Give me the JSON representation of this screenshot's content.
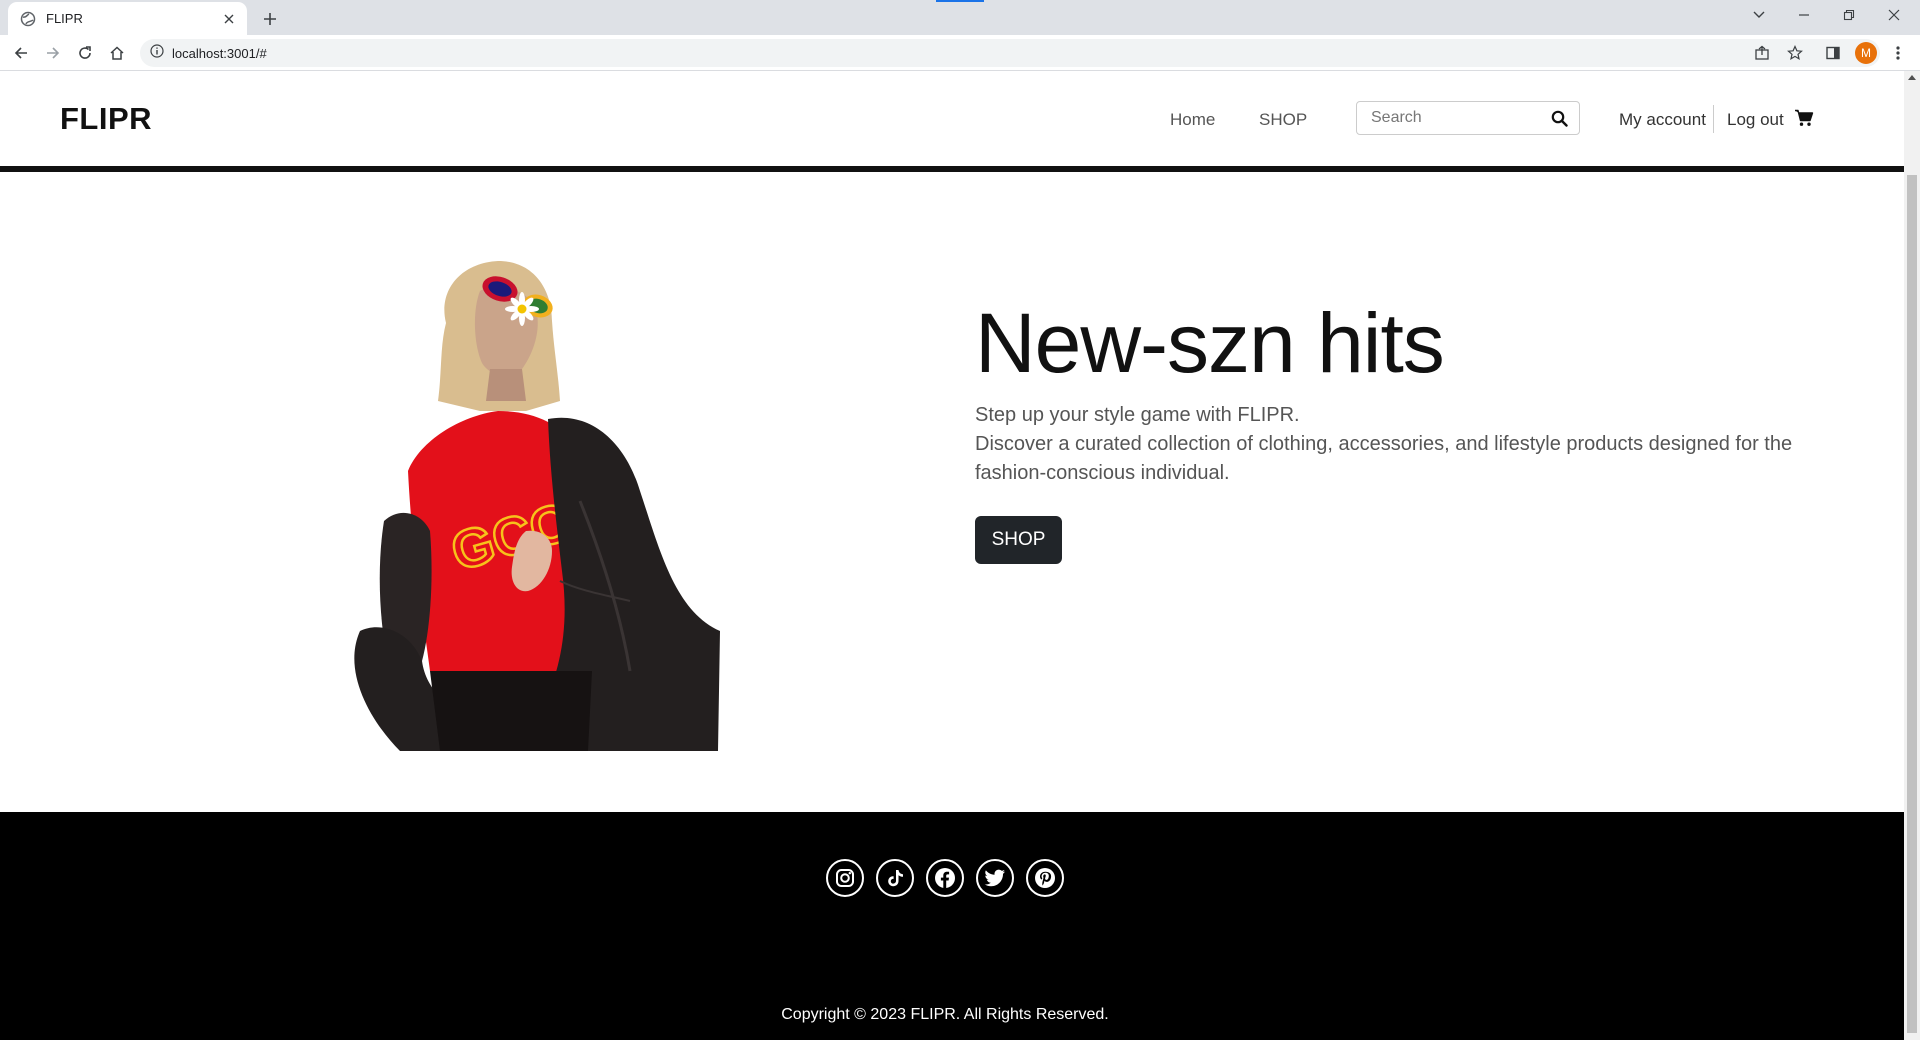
{
  "browser": {
    "tab_title": "FLIPR",
    "url": "localhost:3001/#",
    "profile_initial": "M"
  },
  "header": {
    "logo": "FLIPR",
    "nav": [
      {
        "label": "Home"
      },
      {
        "label": "SHOP"
      }
    ],
    "search_placeholder": "Search",
    "my_account": "My account",
    "log_out": "Log out"
  },
  "hero": {
    "heading": "New-szn hits",
    "line1": "Step up your style game with FLIPR.",
    "line2": "Discover a curated collection of clothing, accessories, and lifestyle products designed for the fashion-conscious individual.",
    "button": "SHOP",
    "shirt_text": "GCC"
  },
  "footer": {
    "social": [
      "instagram-icon",
      "tiktok-icon",
      "facebook-icon",
      "twitter-icon",
      "pinterest-icon"
    ],
    "copyright": "Copyright © 2023 FLIPR. All Rights Reserved."
  },
  "colors": {
    "dark": "#212529",
    "footer_bg": "#000000",
    "shirt_red": "#e3101a",
    "jacket": "#231f1f"
  }
}
